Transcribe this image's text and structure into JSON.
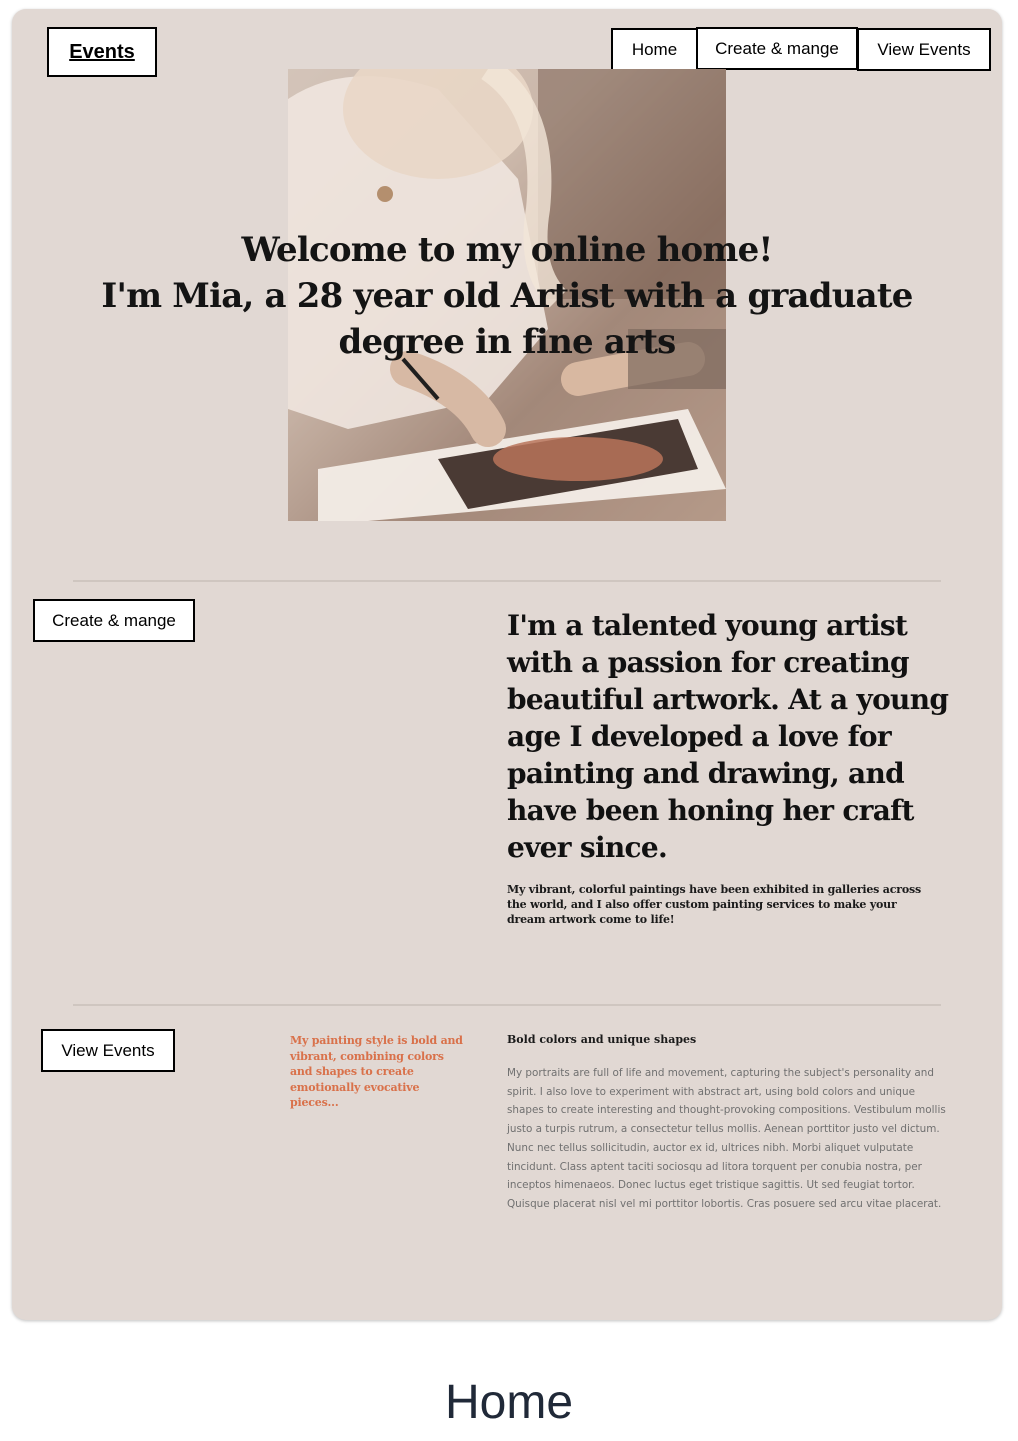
{
  "header": {
    "logo": "Events",
    "nav": [
      "Home",
      "Create & mange",
      "View Events"
    ]
  },
  "hero": {
    "title": "Welcome to my online home!\nI'm Mia, a 28 year old Artist with a graduate degree in fine arts"
  },
  "about": {
    "button": "Create & mange",
    "heading": "I'm a talented young artist with a passion for creating beautiful artwork. At a young age I developed a love for painting and drawing, and have been honing her craft ever since.",
    "sub": "My vibrant, colorful paintings have been exhibited in galleries across the world, and I also offer custom painting services to make your dream artwork come to life!"
  },
  "style": {
    "button": "View Events",
    "quote": "My painting style is bold and vibrant, combining colors and shapes to create emotionally evocative pieces...",
    "heading": "Bold colors and unique shapes",
    "body": "My portraits are full of life and movement, capturing the subject's personality and spirit. I also love to experiment with abstract art, using bold colors and unique shapes to create interesting and thought-provoking compositions. Vestibulum mollis justo a turpis rutrum, a consectetur tellus mollis. Aenean porttitor justo vel dictum. Nunc nec tellus sollicitudin, auctor ex id, ultrices nibh. Morbi aliquet vulputate tincidunt. Class aptent taciti sociosqu ad litora torquent per conubia nostra, per inceptos himenaeos. Donec luctus eget tristique sagittis. Ut sed feugiat tortor. Quisque placerat nisl vel mi porttitor lobortis. Cras posuere sed arcu vitae placerat."
  },
  "caption": "Home",
  "colors": {
    "card_bg": "#e1d8d3",
    "accent_orange": "#d9714a",
    "caption_text": "#202938"
  }
}
